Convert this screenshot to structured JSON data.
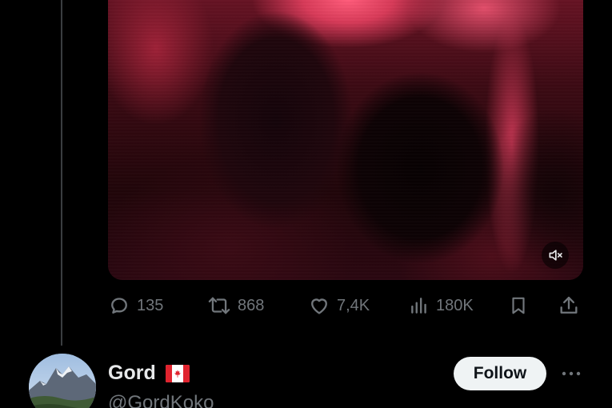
{
  "tweet": {
    "media": {
      "kind": "video",
      "muted": true,
      "mute_icon": "speaker-muted-icon"
    },
    "actions": {
      "reply": {
        "icon": "reply-bubble-icon",
        "count": "135"
      },
      "repost": {
        "icon": "repost-arrows-icon",
        "count": "868"
      },
      "like": {
        "icon": "heart-icon",
        "count": "7,4K"
      },
      "views": {
        "icon": "bar-chart-icon",
        "count": "180K"
      },
      "bookmark": {
        "icon": "bookmark-icon"
      },
      "share": {
        "icon": "share-upload-icon"
      }
    }
  },
  "reply_author": {
    "display_name": "Gord",
    "flag": "canada-flag-icon",
    "handle": "@GordKoko",
    "follow_label": "Follow",
    "more_icon": "more-dots-icon"
  },
  "colors": {
    "background": "#000000",
    "text_primary": "#e7e9ea",
    "text_secondary": "#71767b",
    "follow_bg": "#eff3f4",
    "thread_line": "#3a3d40"
  }
}
